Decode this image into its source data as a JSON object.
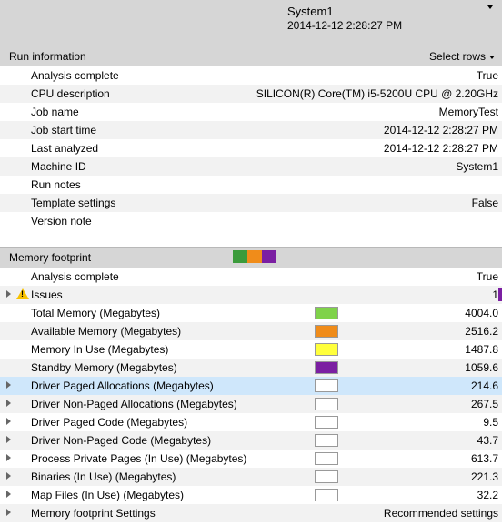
{
  "header": {
    "title": "System1",
    "subtitle": "2014-12-12 2:28:27 PM"
  },
  "sections": {
    "run": {
      "title": "Run information",
      "select_label": "Select rows"
    },
    "mem": {
      "title": "Memory footprint",
      "swatches": [
        "#3b9b3b",
        "#f08c1a",
        "#7b1fa2"
      ]
    }
  },
  "run": {
    "analysis_complete": {
      "label": "Analysis complete",
      "value": "True"
    },
    "cpu": {
      "label": "CPU description",
      "value": "SILICON(R) Core(TM) i5-5200U CPU @ 2.20GHz"
    },
    "job_name": {
      "label": "Job name",
      "value": "MemoryTest"
    },
    "job_start": {
      "label": "Job start time",
      "value": "2014-12-12 2:28:27 PM"
    },
    "last_analyzed": {
      "label": "Last analyzed",
      "value": "2014-12-12 2:28:27 PM"
    },
    "machine_id": {
      "label": "Machine ID",
      "value": "System1"
    },
    "run_notes": {
      "label": "Run notes",
      "value": ""
    },
    "template": {
      "label": "Template settings",
      "value": "False"
    },
    "version": {
      "label": "Version note",
      "value": ""
    }
  },
  "mem": {
    "analysis_complete": {
      "label": "Analysis complete",
      "value": "True"
    },
    "issues": {
      "label": "Issues",
      "value": "1"
    },
    "total": {
      "label": "Total Memory (Megabytes)",
      "value": "4004.0",
      "color": "#7fd24a"
    },
    "avail": {
      "label": "Available Memory (Megabytes)",
      "value": "2516.2",
      "color": "#f08c1a"
    },
    "inuse": {
      "label": "Memory In Use (Megabytes)",
      "value": "1487.8",
      "color": "#ffff3b"
    },
    "standby": {
      "label": "Standby Memory (Megabytes)",
      "value": "1059.6",
      "color": "#7b1fa2"
    },
    "dpa": {
      "label": "Driver Paged Allocations (Megabytes)",
      "value": "214.6",
      "color": "#ffffff"
    },
    "dnpa": {
      "label": "Driver Non-Paged Allocations (Megabytes)",
      "value": "267.5",
      "color": "#ffffff"
    },
    "dpc": {
      "label": "Driver Paged Code (Megabytes)",
      "value": "9.5",
      "color": "#ffffff"
    },
    "dnpc": {
      "label": "Driver Non-Paged Code (Megabytes)",
      "value": "43.7",
      "color": "#ffffff"
    },
    "ppp": {
      "label": "Process Private Pages (In Use) (Megabytes)",
      "value": "613.7",
      "color": "#ffffff"
    },
    "bin": {
      "label": "Binaries (In Use) (Megabytes)",
      "value": "221.3",
      "color": "#ffffff"
    },
    "map": {
      "label": "Map Files (In Use) (Megabytes)",
      "value": "32.2",
      "color": "#ffffff"
    },
    "settings": {
      "label": "Memory footprint Settings",
      "value": "Recommended settings"
    }
  }
}
